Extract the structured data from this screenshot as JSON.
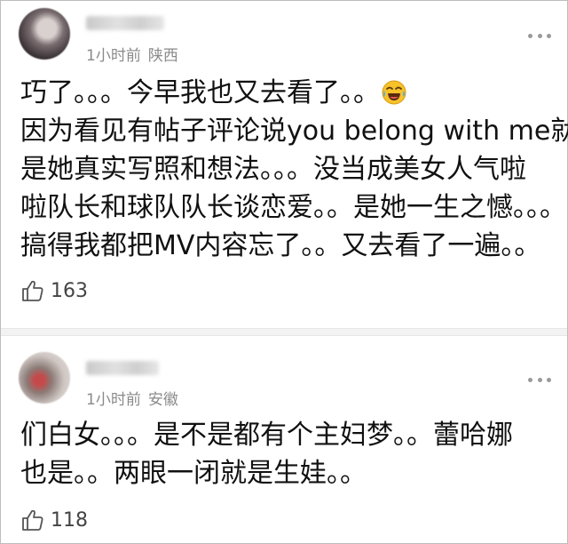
{
  "comments": [
    {
      "time": "1小时前",
      "location": "陕西",
      "lines": [
        "巧了。。。今早我也又去看了。。",
        "因为看见有帖子评论说you belong with me就",
        "是她真实写照和想法。。。没当成美女人气啦",
        "啦队长和球队队长谈恋爱。。是她一生之憾。。。",
        "搞得我都把MV内容忘了。。又去看了一遍。。"
      ],
      "emoji": "laughing-tears-emoji",
      "likes": "163"
    },
    {
      "time": "1小时前",
      "location": "安徽",
      "lines": [
        "们白女。。。是不是都有个主妇梦。。蕾哈娜",
        "也是。。两眼一闭就是生娃。。"
      ],
      "likes": "118"
    }
  ],
  "icons": {
    "more": "more-dots-icon",
    "like": "thumbs-up-icon"
  },
  "colors": {
    "text": "#111111",
    "meta": "#8a8a8a",
    "divider": "#f3f3f3"
  }
}
